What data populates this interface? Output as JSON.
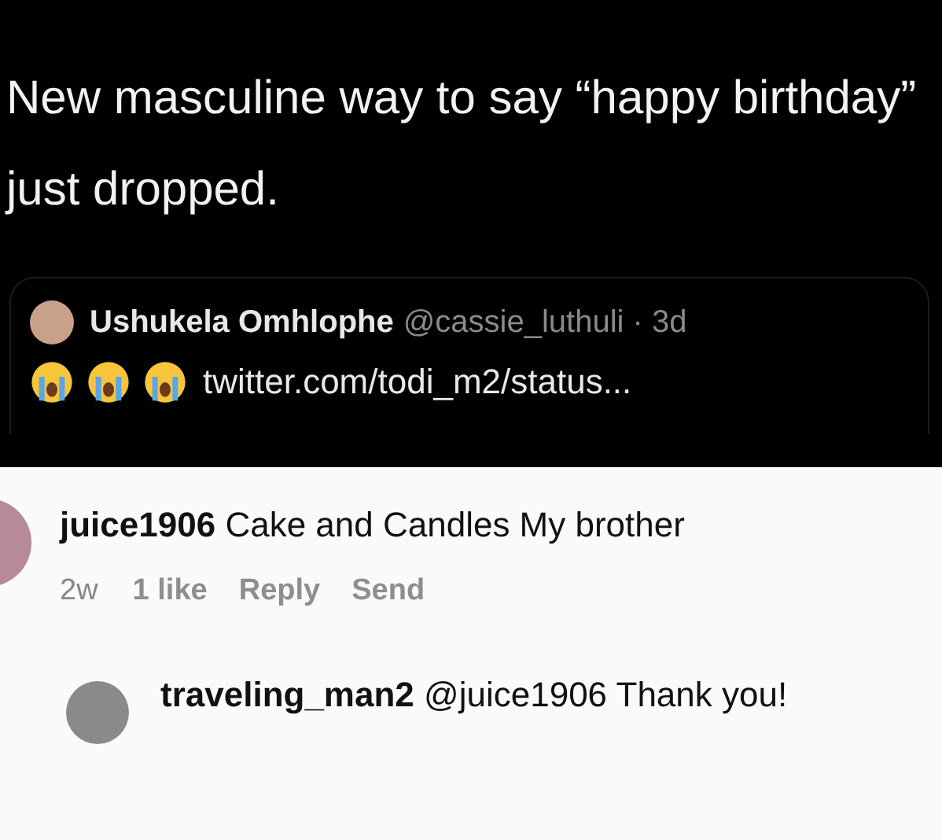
{
  "post": {
    "text": "New masculine way to say “happy birthday” just dropped."
  },
  "quote": {
    "name": "Ushukela Omhlophe",
    "handle": "@cassie_luthuli · 3d",
    "link": "twitter.com/todi_m2/status..."
  },
  "comment": {
    "text": "**juice1906** Cake and Candles My brother",
    "time": "2w",
    "likes": "1 like",
    "actions": [
      "Reply",
      "Send"
    ]
  },
  "reply": {
    "text": "**traveling_man2** @juice1906 Thank you!"
  }
}
